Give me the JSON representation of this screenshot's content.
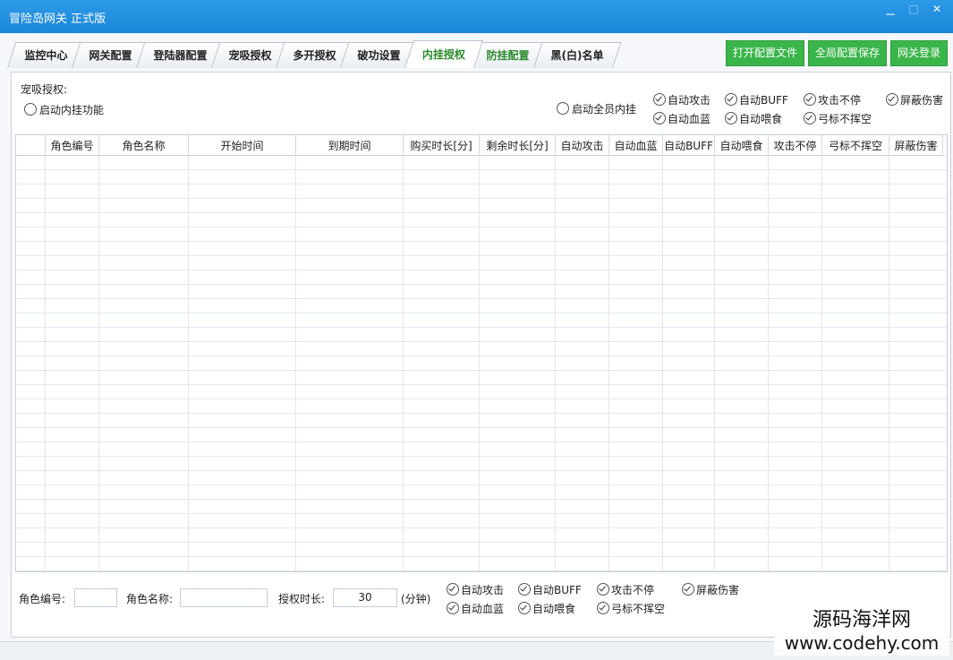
{
  "window": {
    "title": "冒险岛网关 正式版",
    "buttons": [
      "▁",
      "□",
      "✕"
    ]
  },
  "tabs": [
    {
      "label": "监控中心",
      "state": "normal"
    },
    {
      "label": "网关配置",
      "state": "normal"
    },
    {
      "label": "登陆器配置",
      "state": "normal"
    },
    {
      "label": "宠吸授权",
      "state": "normal"
    },
    {
      "label": "多开授权",
      "state": "normal"
    },
    {
      "label": "破功设置",
      "state": "normal"
    },
    {
      "label": "内挂授权",
      "state": "active"
    },
    {
      "label": "防挂配置",
      "state": "green"
    },
    {
      "label": "黑(白)名单",
      "state": "normal"
    }
  ],
  "top_buttons": [
    "打开配置文件",
    "全局配置保存",
    "网关登录"
  ],
  "section_label": "宠吸授权:",
  "enable_radio": "启动内挂功能",
  "all_members_radio": "启动全员内挂",
  "top_options": [
    "自动攻击",
    "自动BUFF",
    "攻击不停",
    "屏蔽伤害",
    "自动血蓝",
    "自动喂食",
    "弓标不挥空"
  ],
  "table": {
    "columns": [
      "",
      "角色编号",
      "角色名称",
      "开始时间",
      "到期时间",
      "购买时长[分]",
      "剩余时长[分]",
      "自动攻击",
      "自动血蓝",
      "自动BUFF",
      "自动喂食",
      "攻击不停",
      "弓标不挥空",
      "屏蔽伤害"
    ]
  },
  "form": {
    "role_id_label": "角色编号:",
    "role_id_value": "",
    "role_name_label": "角色名称:",
    "role_name_value": "",
    "duration_label": "授权时长:",
    "duration_value": "30",
    "duration_unit": "(分钟)"
  },
  "bottom_options": [
    "自动攻击",
    "自动BUFF",
    "攻击不停",
    "屏蔽伤害",
    "自动血蓝",
    "自动喂食",
    "弓标不挥空"
  ],
  "watermark": {
    "line1": "源码海洋网",
    "line2": "www.codehy.com"
  }
}
